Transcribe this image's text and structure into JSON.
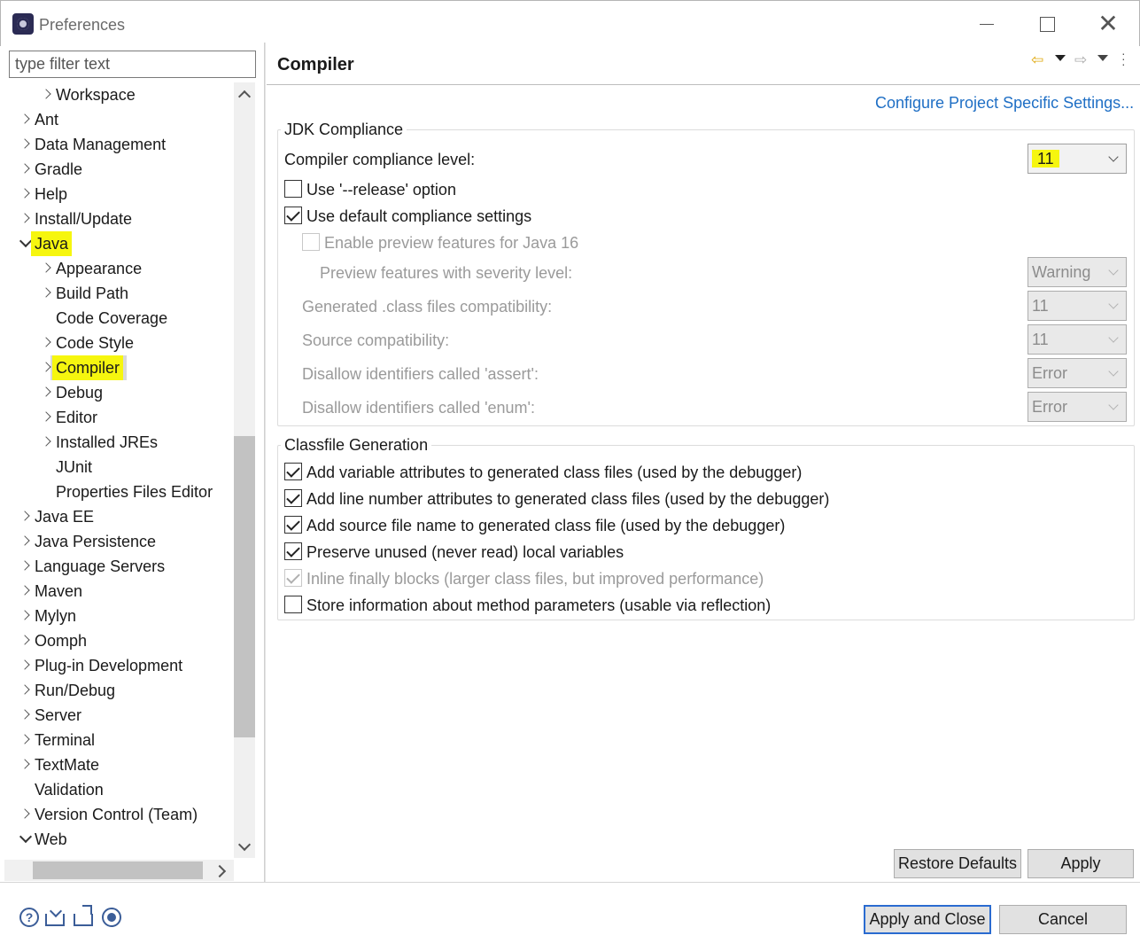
{
  "window": {
    "title": "Preferences",
    "close_glyph": "✕"
  },
  "filter": {
    "placeholder": "type filter text"
  },
  "tree": {
    "items": [
      {
        "label": "Workspace",
        "indent": 1,
        "expander": "right"
      },
      {
        "label": "Ant",
        "indent": 0,
        "expander": "right"
      },
      {
        "label": "Data Management",
        "indent": 0,
        "expander": "right"
      },
      {
        "label": "Gradle",
        "indent": 0,
        "expander": "right"
      },
      {
        "label": "Help",
        "indent": 0,
        "expander": "right"
      },
      {
        "label": "Install/Update",
        "indent": 0,
        "expander": "right"
      },
      {
        "label": "Java",
        "indent": 0,
        "expander": "down",
        "highlighted": true
      },
      {
        "label": "Appearance",
        "indent": 1,
        "expander": "right"
      },
      {
        "label": "Build Path",
        "indent": 1,
        "expander": "right"
      },
      {
        "label": "Code Coverage",
        "indent": 1,
        "expander": "none"
      },
      {
        "label": "Code Style",
        "indent": 1,
        "expander": "right"
      },
      {
        "label": "Compiler",
        "indent": 1,
        "expander": "right",
        "highlighted": true,
        "selected": true
      },
      {
        "label": "Debug",
        "indent": 1,
        "expander": "right"
      },
      {
        "label": "Editor",
        "indent": 1,
        "expander": "right"
      },
      {
        "label": "Installed JREs",
        "indent": 1,
        "expander": "right"
      },
      {
        "label": "JUnit",
        "indent": 1,
        "expander": "none"
      },
      {
        "label": "Properties Files Editor",
        "indent": 1,
        "expander": "none"
      },
      {
        "label": "Java EE",
        "indent": 0,
        "expander": "right"
      },
      {
        "label": "Java Persistence",
        "indent": 0,
        "expander": "right"
      },
      {
        "label": "Language Servers",
        "indent": 0,
        "expander": "right"
      },
      {
        "label": "Maven",
        "indent": 0,
        "expander": "right"
      },
      {
        "label": "Mylyn",
        "indent": 0,
        "expander": "right"
      },
      {
        "label": "Oomph",
        "indent": 0,
        "expander": "right"
      },
      {
        "label": "Plug-in Development",
        "indent": 0,
        "expander": "right"
      },
      {
        "label": "Run/Debug",
        "indent": 0,
        "expander": "right"
      },
      {
        "label": "Server",
        "indent": 0,
        "expander": "right"
      },
      {
        "label": "Terminal",
        "indent": 0,
        "expander": "right"
      },
      {
        "label": "TextMate",
        "indent": 0,
        "expander": "right"
      },
      {
        "label": "Validation",
        "indent": 0,
        "expander": "none"
      },
      {
        "label": "Version Control (Team)",
        "indent": 0,
        "expander": "right"
      },
      {
        "label": "Web",
        "indent": 0,
        "expander": "down"
      }
    ]
  },
  "page": {
    "title": "Compiler",
    "config_link": "Configure Project Specific Settings...",
    "jdk": {
      "group_title": "JDK Compliance",
      "compliance_label": "Compiler compliance level:",
      "compliance_value": "11",
      "release_option": "Use '--release' option",
      "release_checked": false,
      "default_settings": "Use default compliance settings",
      "default_checked": true,
      "preview": "Enable preview features for Java 16",
      "preview_checked": false,
      "preview_severity_label": "Preview features with severity level:",
      "preview_severity_value": "Warning",
      "generated_label": "Generated .class files compatibility:",
      "generated_value": "11",
      "source_label": "Source compatibility:",
      "source_value": "11",
      "assert_label": "Disallow identifiers called 'assert':",
      "assert_value": "Error",
      "enum_label": "Disallow identifiers called 'enum':",
      "enum_value": "Error"
    },
    "classfile": {
      "group_title": "Classfile Generation",
      "options": [
        {
          "label": "Add variable attributes to generated class files (used by the debugger)",
          "checked": true,
          "enabled": true
        },
        {
          "label": "Add line number attributes to generated class files (used by the debugger)",
          "checked": true,
          "enabled": true
        },
        {
          "label": "Add source file name to generated class file (used by the debugger)",
          "checked": true,
          "enabled": true
        },
        {
          "label": "Preserve unused (never read) local variables",
          "checked": true,
          "enabled": true
        },
        {
          "label": "Inline finally blocks (larger class files, but improved performance)",
          "checked": true,
          "enabled": false
        },
        {
          "label": "Store information about method parameters (usable via reflection)",
          "checked": false,
          "enabled": true
        }
      ]
    },
    "buttons": {
      "restore": "Restore Defaults",
      "apply": "Apply"
    }
  },
  "footer": {
    "apply_close": "Apply and Close",
    "cancel": "Cancel",
    "help_glyph": "?"
  },
  "colors": {
    "highlight": "#f6f60f",
    "link": "#1f6fc5",
    "default_button_border": "#2a6bd0"
  }
}
